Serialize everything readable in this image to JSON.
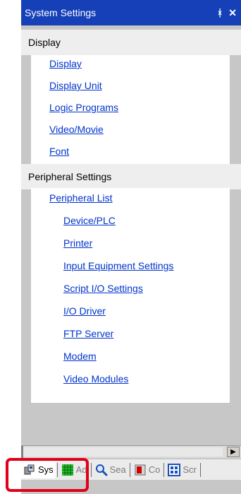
{
  "window": {
    "title": "System Settings",
    "pin_glyph": "ᚼ",
    "close_glyph": "✕"
  },
  "groups": {
    "display": {
      "header": "Display",
      "items": [
        "Display",
        "Display Unit",
        "Logic Programs",
        "Video/Movie",
        "Font"
      ]
    },
    "peripheral": {
      "header": "Peripheral Settings",
      "list_label": "Peripheral List",
      "items": [
        "Device/PLC",
        "Printer",
        "Input Equipment Settings",
        "Script I/O Settings",
        "I/O Driver",
        "FTP Server",
        "Modem",
        "Video Modules"
      ]
    }
  },
  "scrollbar": {
    "right_arrow": "▶"
  },
  "tabs": [
    {
      "icon": "system-settings-icon",
      "label": "Sys"
    },
    {
      "icon": "address-grid-icon",
      "label": "Ad"
    },
    {
      "icon": "search-icon",
      "label": "Sea"
    },
    {
      "icon": "common-settings-icon",
      "label": "Co"
    },
    {
      "icon": "screen-list-icon",
      "label": "Scr"
    }
  ],
  "colors": {
    "title_bar": "#1640b8",
    "link": "#0033cc",
    "highlight": "#e0001b"
  }
}
